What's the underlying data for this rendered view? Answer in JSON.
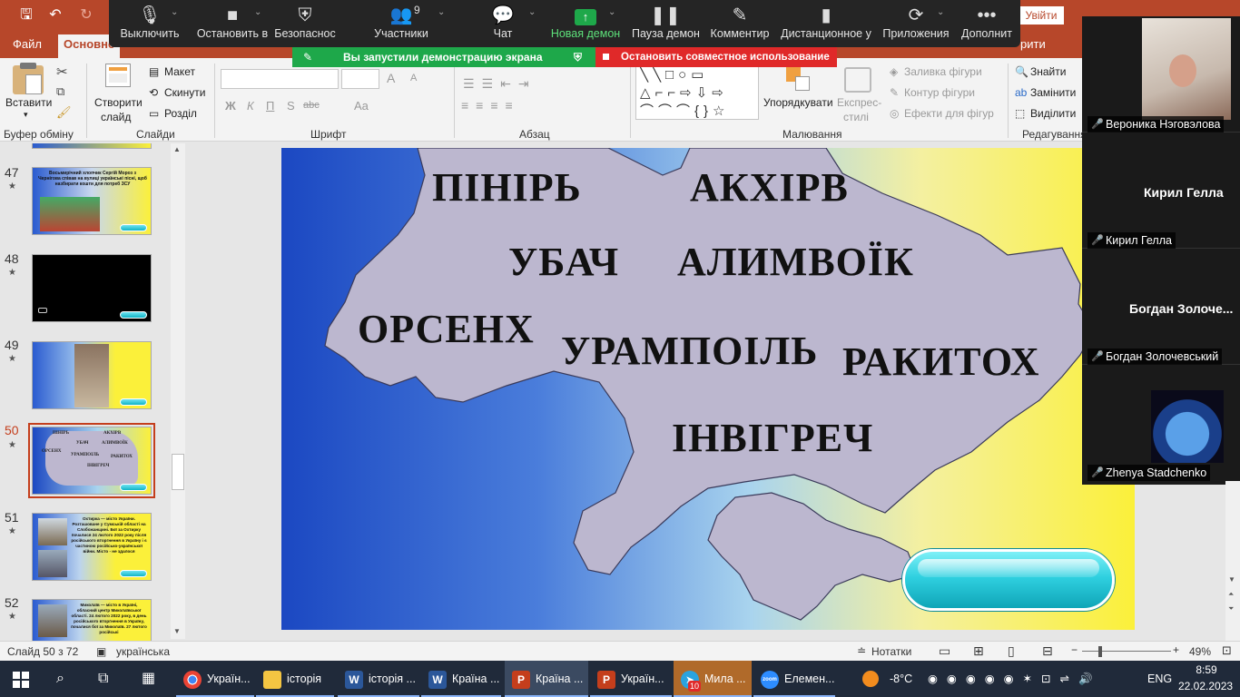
{
  "app": {
    "colors": {
      "brand": "#b7472a",
      "zoom_bg": "#252525",
      "share_green": "#1ea84a",
      "stop_red": "#e02929"
    },
    "login_label": "Увійти"
  },
  "menu": {
    "tabs": [
      "Файл",
      "Основне"
    ],
    "right_fragment": "рити"
  },
  "ribbon": {
    "clipboard": {
      "paste": "Вставити",
      "group": "Буфер обміну"
    },
    "slides": {
      "new_slide_1": "Створити",
      "new_slide_2": "слайд",
      "layout": "Макет",
      "reset": "Скинути",
      "section": "Розділ",
      "group": "Слайди"
    },
    "font": {
      "group": "Шрифт",
      "bold": "Ж",
      "italic": "К",
      "underline": "П",
      "strike": "S",
      "abc": "abc",
      "aa": "Aa",
      "grow": "A",
      "shrink": "A"
    },
    "paragraph": {
      "group": "Абзац"
    },
    "drawing": {
      "arrange": "Упорядкувати",
      "quick_styles_1": "Експрес-",
      "quick_styles_2": "стилі",
      "fill": "Заливка фігури",
      "outline": "Контур фігури",
      "effects": "Ефекти для фігур",
      "group": "Малювання"
    },
    "editing": {
      "find": "Знайти",
      "replace": "Замінити",
      "select": "Виділити",
      "group": "Редагування"
    }
  },
  "zoom": {
    "participants_count": "9",
    "items": [
      "Выключить",
      "Остановить в",
      "Безопаснос",
      "Участники",
      "Чат",
      "Новая демон",
      "Пауза демон",
      "Комментир",
      "Дистанционное у",
      "Приложения",
      "Дополнит"
    ],
    "share_banner": "Вы запустили демонстрацию экрана",
    "stop_share": "Остановить совместное использование"
  },
  "slides": [
    {
      "num": "47",
      "text": "Восьмирічний хлопчик Сергій Мороз з Чернігова співав на вулиці українські пісні, щоб назбирати кошти для потреб ЗСУ"
    },
    {
      "num": "48",
      "text": ""
    },
    {
      "num": "49",
      "text": ""
    },
    {
      "num": "50",
      "text": ""
    },
    {
      "num": "51",
      "text": "Охтирка — місто України. Розташоване у Сумській області на Слобожанщині. Бої за Охтирку почалися 24 лютого 2022 року після російського вторгнення в Україну і є частиною російсько-української війни. Місто - не здалося"
    },
    {
      "num": "52",
      "text": "Миколаїв — місто в Україні, обласний центр Миколаївської області. 24 лютого 2022 року, в день російського вторгнення в Україну, почалися бої за Миколаїв. 27 лютого російські"
    }
  ],
  "thumb50_words": [
    "ПІНІРЬ",
    "АКХІРВ",
    "УБАЧ",
    "АЛИМВОЇК",
    "ОРСЕНХ",
    "УРАМПОІЛЬ",
    "РАКИТОХ",
    "ІНВІГРЕЧ"
  ],
  "current_slide": {
    "words": [
      "ПІНІРЬ",
      "АКХІРВ",
      "УБАЧ",
      "АЛИМВОЇК",
      "ОРСЕНХ",
      "УРАМПОІЛЬ",
      "РАКИТОХ",
      "ІНВІГРЕЧ"
    ]
  },
  "participants": [
    {
      "name": "Вероника Нэговэлова",
      "display": ""
    },
    {
      "name": "Кирил Гелла",
      "display": "Кирил Гелла"
    },
    {
      "name": "Богдан Золочевський",
      "display": "Богдан  Золоче..."
    },
    {
      "name": "Zhenya Stadchenko",
      "display": ""
    }
  ],
  "status": {
    "slide_counter": "Слайд 50 з 72",
    "language": "українська",
    "notes": "Нотатки",
    "zoom": "49%"
  },
  "taskbar": {
    "apps": [
      "Україн...",
      "історія",
      "історія ...",
      "Країна ...",
      "Країна ...",
      "Україн...",
      "Мила ...",
      "Елемен..."
    ],
    "badge": "10",
    "weather": "-8°C",
    "lang": "ENG",
    "time": "8:59",
    "date": "22.02.2023"
  }
}
